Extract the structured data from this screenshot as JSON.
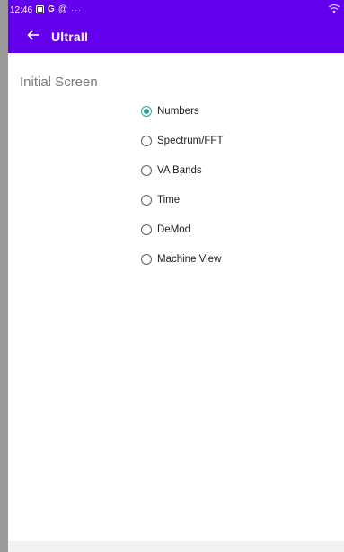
{
  "status_bar": {
    "time": "12:46",
    "icons": [
      "sim-icon",
      "google-icon",
      "at-icon"
    ],
    "overflow": "···",
    "wifi_icon": "wifi-icon"
  },
  "app_bar": {
    "title": "UltraII",
    "back_icon": "arrow-left-icon",
    "background": "#6200ee"
  },
  "section": {
    "title": "Initial Screen"
  },
  "options": [
    {
      "label": "Numbers",
      "checked": true
    },
    {
      "label": "Spectrum/FFT",
      "checked": false
    },
    {
      "label": "VA Bands",
      "checked": false
    },
    {
      "label": "Time",
      "checked": false
    },
    {
      "label": "DeMod",
      "checked": false
    },
    {
      "label": "Machine View",
      "checked": false
    }
  ],
  "colors": {
    "accent": "#26a69a",
    "primary": "#6200ee"
  }
}
